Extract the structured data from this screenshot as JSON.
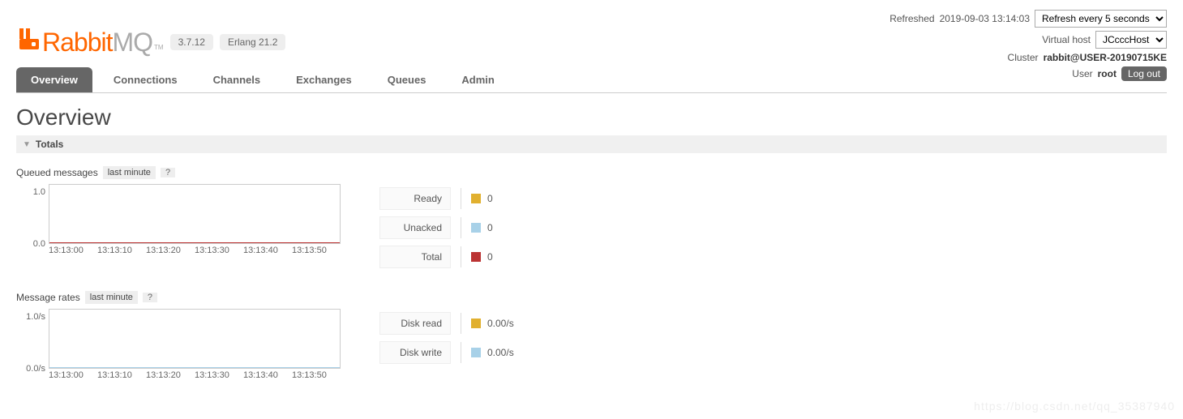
{
  "header": {
    "refreshed_label": "Refreshed",
    "refreshed_time": "2019-09-03 13:14:03",
    "refresh_select": "Refresh every 5 seconds",
    "vhost_label": "Virtual host",
    "vhost_value": "JCcccHost",
    "cluster_label": "Cluster",
    "cluster_value": "rabbit@USER-20190715KE",
    "user_label": "User",
    "user_value": "root",
    "logout": "Log out"
  },
  "logo": {
    "text1": "Rabbit",
    "text2": "MQ",
    "tm": "TM"
  },
  "pills": {
    "version": "3.7.12",
    "erlang": "Erlang 21.2"
  },
  "tabs": [
    "Overview",
    "Connections",
    "Channels",
    "Exchanges",
    "Queues",
    "Admin"
  ],
  "page_title": "Overview",
  "section": {
    "title": "Totals"
  },
  "queued": {
    "label": "Queued messages",
    "range": "last minute",
    "help": "?",
    "y_top": "1.0",
    "y_bot": "0.0",
    "x_ticks": [
      "13:13:00",
      "13:13:10",
      "13:13:20",
      "13:13:30",
      "13:13:40",
      "13:13:50"
    ],
    "legend": [
      {
        "name": "Ready",
        "color": "#e1b02f",
        "value": "0"
      },
      {
        "name": "Unacked",
        "color": "#a8d1e8",
        "value": "0"
      },
      {
        "name": "Total",
        "color": "#b33",
        "value": "0"
      }
    ]
  },
  "rates": {
    "label": "Message rates",
    "range": "last minute",
    "help": "?",
    "y_top": "1.0/s",
    "y_bot": "0.0/s",
    "x_ticks": [
      "13:13:00",
      "13:13:10",
      "13:13:20",
      "13:13:30",
      "13:13:40",
      "13:13:50"
    ],
    "legend": [
      {
        "name": "Disk read",
        "color": "#e1b02f",
        "value": "0.00/s"
      },
      {
        "name": "Disk write",
        "color": "#a8d1e8",
        "value": "0.00/s"
      }
    ]
  },
  "chart_data": [
    {
      "type": "line",
      "title": "Queued messages",
      "xlabel": "",
      "ylabel": "",
      "ylim": [
        0,
        1
      ],
      "categories": [
        "13:13:00",
        "13:13:10",
        "13:13:20",
        "13:13:30",
        "13:13:40",
        "13:13:50"
      ],
      "series": [
        {
          "name": "Ready",
          "values": [
            0,
            0,
            0,
            0,
            0,
            0
          ]
        },
        {
          "name": "Unacked",
          "values": [
            0,
            0,
            0,
            0,
            0,
            0
          ]
        },
        {
          "name": "Total",
          "values": [
            0,
            0,
            0,
            0,
            0,
            0
          ]
        }
      ]
    },
    {
      "type": "line",
      "title": "Message rates",
      "xlabel": "",
      "ylabel": "/s",
      "ylim": [
        0,
        1
      ],
      "categories": [
        "13:13:00",
        "13:13:10",
        "13:13:20",
        "13:13:30",
        "13:13:40",
        "13:13:50"
      ],
      "series": [
        {
          "name": "Disk read",
          "values": [
            0,
            0,
            0,
            0,
            0,
            0
          ]
        },
        {
          "name": "Disk write",
          "values": [
            0,
            0,
            0,
            0,
            0,
            0
          ]
        }
      ]
    }
  ],
  "watermark": "https://blog.csdn.net/qq_35387940"
}
